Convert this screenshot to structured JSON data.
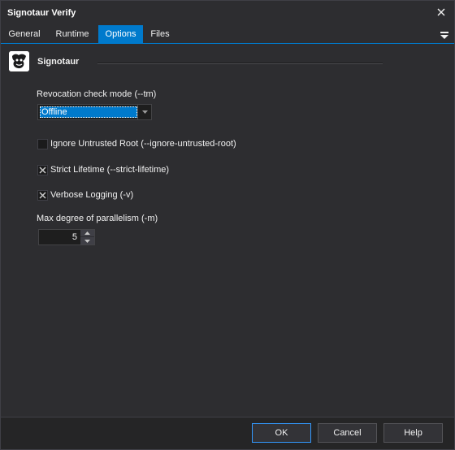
{
  "window": {
    "title": "Signotaur Verify"
  },
  "tabs": [
    {
      "label": "General",
      "active": false
    },
    {
      "label": "Runtime",
      "active": false
    },
    {
      "label": "Options",
      "active": true
    },
    {
      "label": "Files",
      "active": false
    }
  ],
  "header": {
    "app_name": "Signotaur",
    "icon": "signotaur-logo-icon"
  },
  "revocation": {
    "label": "Revocation check mode (--tm)",
    "selected": "Offline"
  },
  "checkboxes": {
    "ignore_untrusted_root": {
      "label": "Ignore Untrusted Root (--ignore-untrusted-root)",
      "checked": false
    },
    "strict_lifetime": {
      "label": "Strict Lifetime (--strict-lifetime)",
      "checked": true
    },
    "verbose_logging": {
      "label": "Verbose Logging (-v)",
      "checked": true
    }
  },
  "parallelism": {
    "label": "Max degree of parallelism (-m)",
    "value": "5"
  },
  "buttons": {
    "ok": "OK",
    "cancel": "Cancel",
    "help": "Help"
  },
  "colors": {
    "accent": "#007acc",
    "background": "#2d2d30",
    "footer": "#252526"
  }
}
